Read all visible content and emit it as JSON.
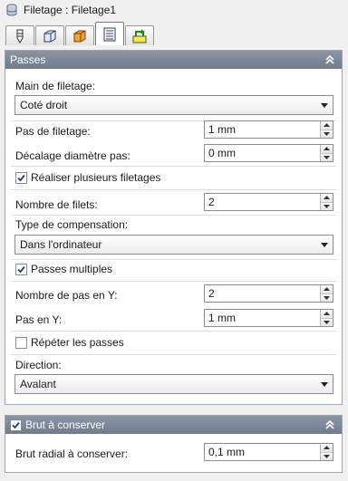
{
  "window": {
    "title": "Filetage : Filetage1"
  },
  "tabs": [
    {
      "icon": "tool-icon"
    },
    {
      "icon": "cube-icon"
    },
    {
      "icon": "stock-cube-icon"
    },
    {
      "icon": "passes-list-icon"
    },
    {
      "icon": "linking-icon"
    }
  ],
  "passes": {
    "header": "Passes",
    "thread_hand_label": "Main de filetage:",
    "thread_hand_value": "Coté droit",
    "thread_pitch_label": "Pas de filetage:",
    "thread_pitch_value": "1 mm",
    "pitch_offset_label": "Décalage diamètre pas:",
    "pitch_offset_value": "0 mm",
    "multiple_threads_label": "Réaliser plusieurs filetages",
    "multiple_threads_checked": true,
    "thread_count_label": "Nombre de filets:",
    "thread_count_value": "2",
    "compensation_label": "Type de compensation:",
    "compensation_value": "Dans l'ordinateur",
    "multiple_passes_label": "Passes multiples",
    "multiple_passes_checked": true,
    "y_steps_label": "Nombre de pas en Y:",
    "y_steps_value": "2",
    "y_step_label": "Pas en Y:",
    "y_step_value": "1 mm",
    "repeat_passes_label": "Répéter les passes",
    "repeat_passes_checked": false,
    "direction_label": "Direction:",
    "direction_value": "Avalant"
  },
  "stock": {
    "header": "Brut à conserver",
    "header_checked": true,
    "radial_label": "Brut radial à conserver:",
    "radial_value": "0,1 mm"
  }
}
